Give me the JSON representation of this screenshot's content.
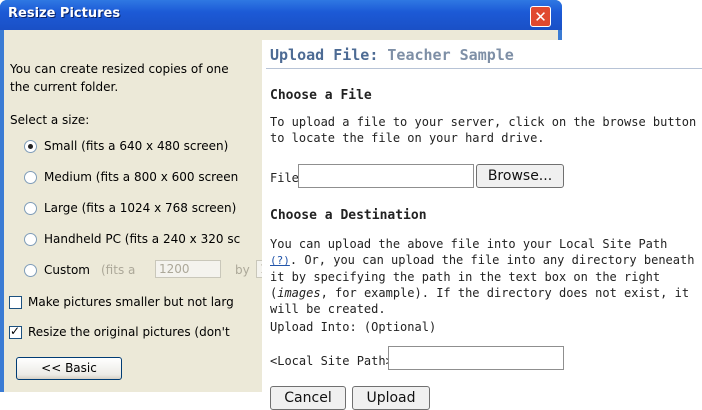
{
  "resize_dialog": {
    "title": "Resize Pictures",
    "close_glyph": "✕",
    "intro_line1": "You can create resized copies of one",
    "intro_line2": "the current folder.",
    "select_label": "Select a size:",
    "sizes": [
      {
        "label": "Small (fits a 640 x 480 screen)",
        "selected": true
      },
      {
        "label": "Medium (fits a 800 x 600 screen",
        "selected": false
      },
      {
        "label": "Large (fits a 1024 x 768 screen)",
        "selected": false
      },
      {
        "label": "Handheld PC (fits a 240 x 320 sc",
        "selected": false
      },
      {
        "label": "Custom",
        "selected": false
      }
    ],
    "custom_fits_label": "(fits a",
    "custom_width_value": "1200",
    "custom_by_label": "by",
    "custom_height_value": "1",
    "make_smaller_label": "Make pictures smaller but not larg",
    "make_smaller_checked": false,
    "resize_original_label": "Resize the original pictures (don't",
    "resize_original_checked": true,
    "basic_button": "<< Basic"
  },
  "upload": {
    "title": "Upload File",
    "title_sep": ":",
    "subtitle": "Teacher Sample",
    "choose_file_heading": "Choose a File",
    "choose_file_text": "To upload a file to your server, click on the browse button to locate the file on your hard drive.",
    "file_label": "File:",
    "file_value": "",
    "browse_button": "Browse...",
    "choose_dest_heading": "Choose a Destination",
    "dest_text_a": "You can upload the above file into your Local Site Path",
    "help_link": "(?)",
    "dest_text_b": ". Or, you can upload the file into any directory beneath it by specifying the path in the text box on the right (",
    "dest_example": "images",
    "dest_text_c": ", for example). If the directory does not exist, it will be created.",
    "upload_into_label": "Upload Into: (Optional)",
    "local_path_label": "<Local Site Path> /",
    "path_value": "",
    "cancel_button": "Cancel",
    "upload_button": "Upload"
  },
  "colors": {
    "xp_title_blue": "#1c5ad6",
    "dialog_face": "#ece9d8",
    "upload_title": "#4d6b94"
  }
}
